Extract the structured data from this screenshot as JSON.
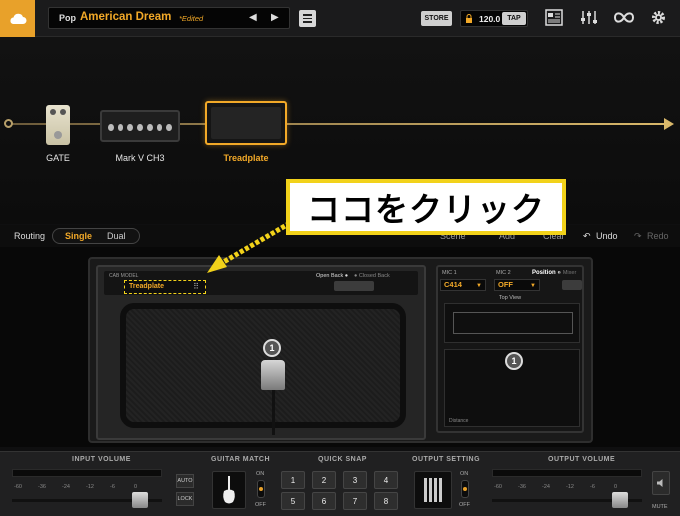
{
  "topbar": {
    "preset_category": "Pop",
    "preset_name": "American Dream",
    "preset_status": "*Edited",
    "prev_icon": "triangle-left-icon",
    "next_icon": "triangle-right-icon",
    "store_label": "STORE",
    "tempo": "120.0",
    "tap_label": "TAP",
    "accent": "#f2a928"
  },
  "chain": {
    "modules": [
      {
        "label": "GATE"
      },
      {
        "label": "Mark V CH3"
      },
      {
        "label": "Treadplate"
      }
    ]
  },
  "callout": {
    "text": "ココをクリック",
    "border_color": "#f2d21a"
  },
  "routing": {
    "label": "Routing",
    "options": [
      "Single",
      "Dual"
    ],
    "selected": "Single",
    "tools": [
      "Scene",
      "Add",
      "Clear",
      "Undo",
      "Redo"
    ]
  },
  "cab": {
    "model_label": "CAB MODEL",
    "model_value": "Treadplate",
    "open_back": "Open Back ●",
    "closed_back": "● Closed Back",
    "mic_badge": "1"
  },
  "mics": {
    "mic1_label": "MIC 1",
    "mic1_value": "C414",
    "mic2_label": "MIC 2",
    "mic2_value": "OFF",
    "position_label": "Position ●",
    "mixer_label": "● Mixer",
    "topview_label": "Top View",
    "distance_label": "Distance",
    "badge": "1"
  },
  "bottom": {
    "input_title": "INPUT VOLUME",
    "guitar_title": "GUITAR MATCH",
    "snap_title": "QUICK SNAP",
    "output_setting_title": "OUTPUT SETTING",
    "output_title": "OUTPUT VOLUME",
    "scale": [
      "-60",
      "-36",
      "-24",
      "-12",
      "-6",
      "0"
    ],
    "auto_label": "AUTO",
    "lock_label": "LOCK",
    "on_label": "ON",
    "off_label": "OFF",
    "mute_label": "MUTE",
    "snaps": [
      "1",
      "2",
      "3",
      "4",
      "5",
      "6",
      "7",
      "8"
    ]
  }
}
